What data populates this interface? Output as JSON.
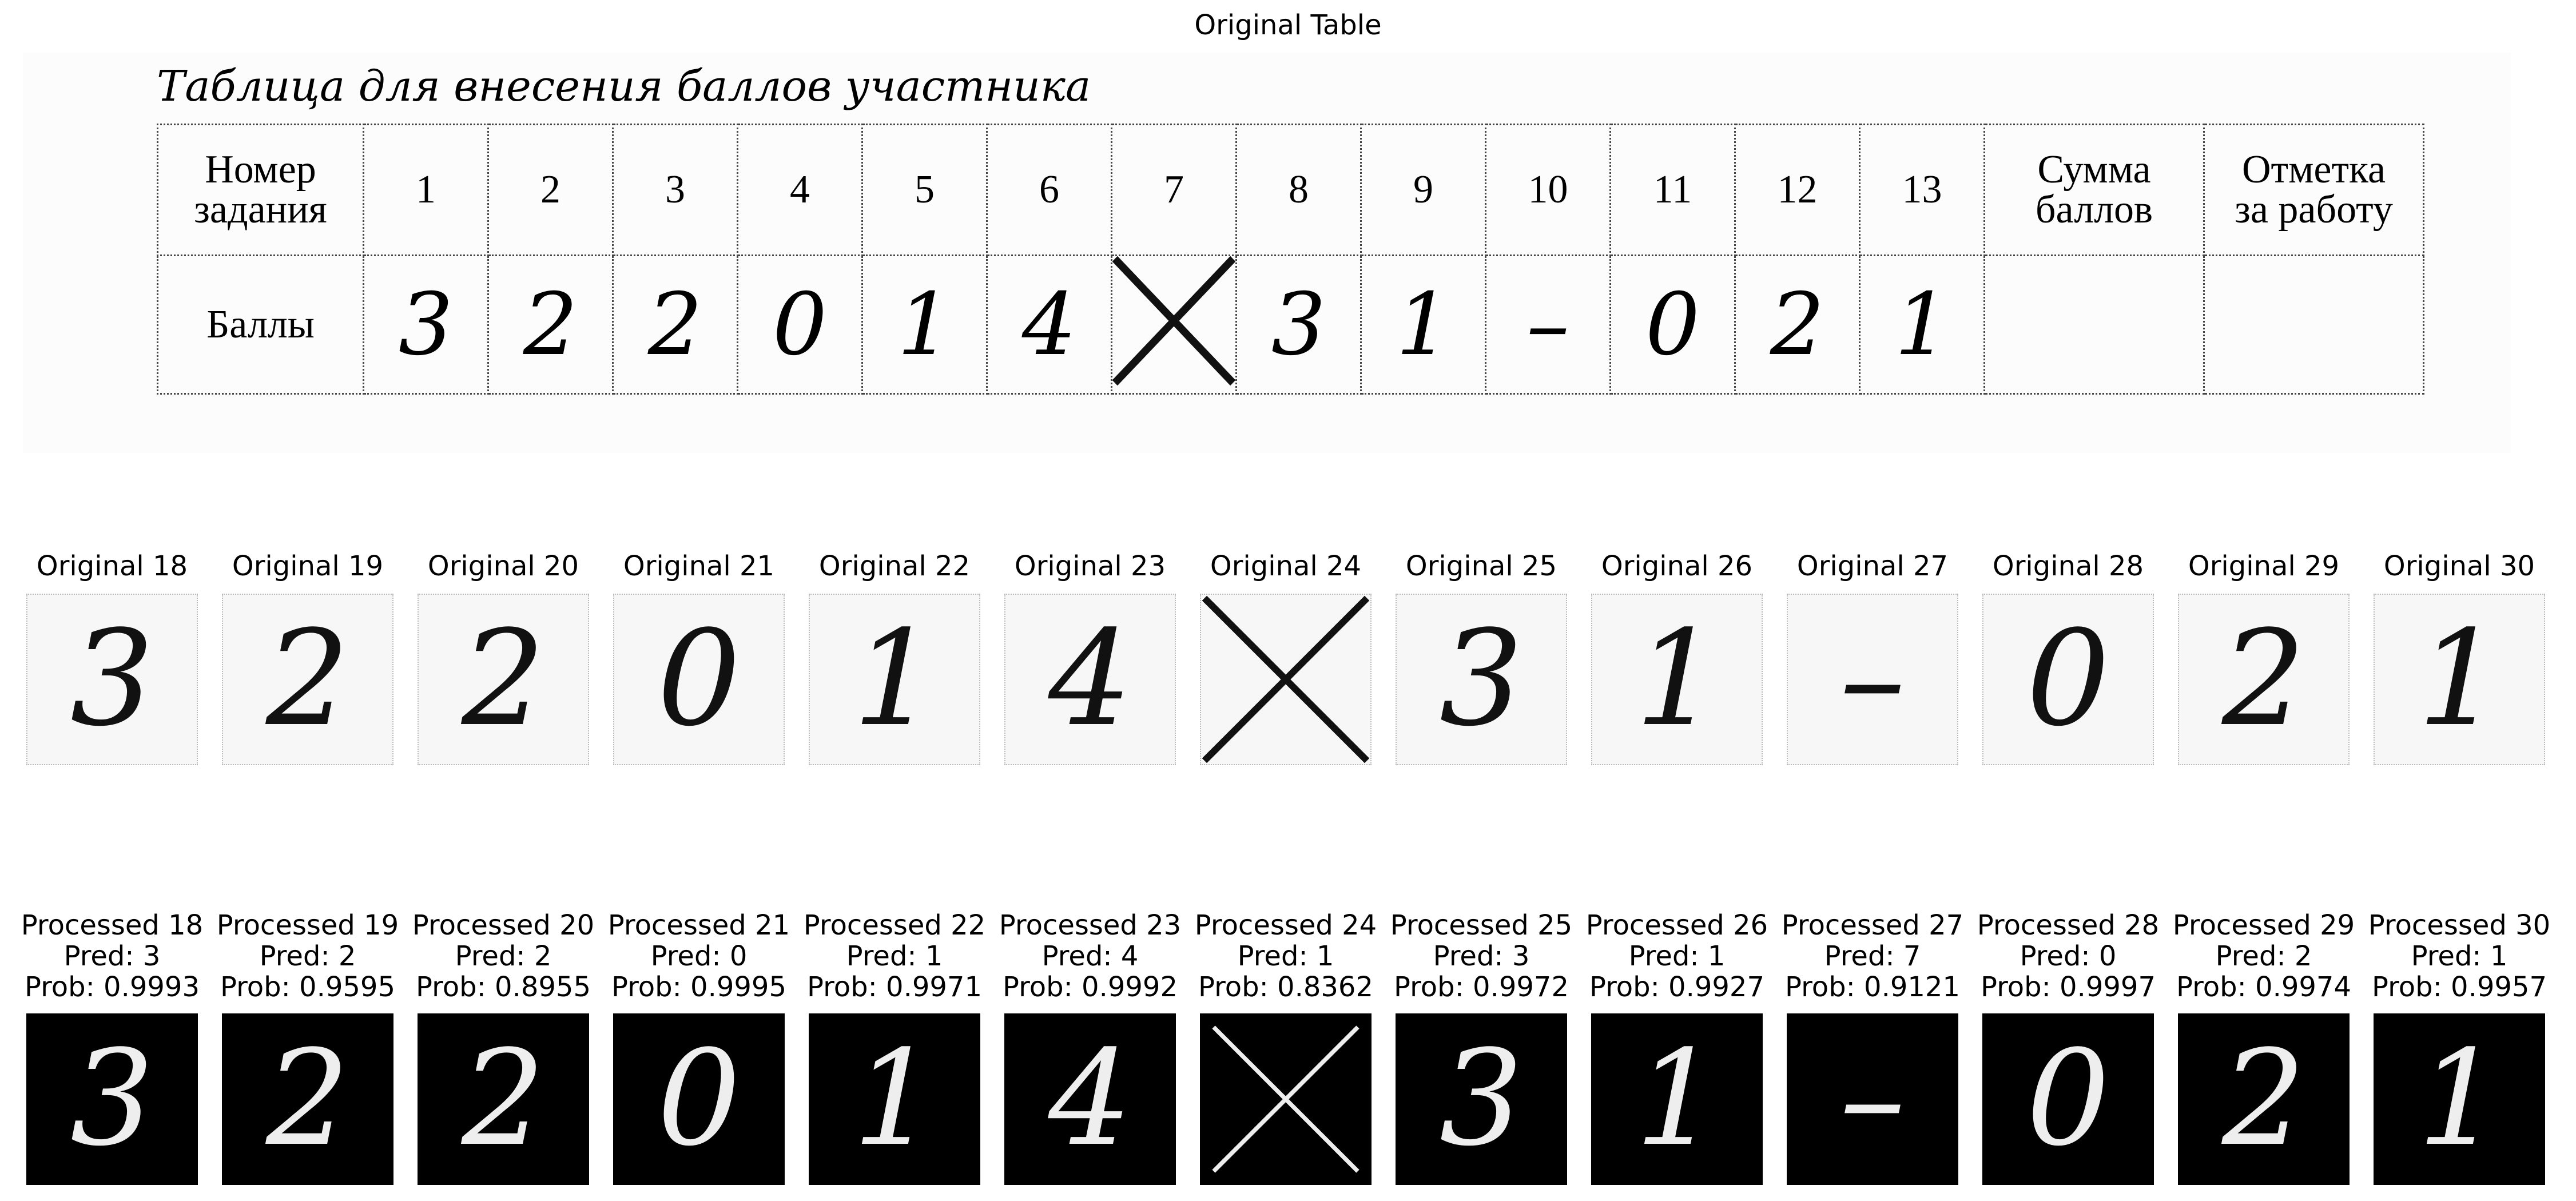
{
  "figure": {
    "title": "Original Table"
  },
  "scan": {
    "caption": "Таблица для внесения баллов участника",
    "header_label": [
      "Номер",
      "задания"
    ],
    "score_label": "Баллы",
    "task_numbers": [
      "1",
      "2",
      "3",
      "4",
      "5",
      "6",
      "7",
      "8",
      "9",
      "10",
      "11",
      "12",
      "13"
    ],
    "scores": [
      "3",
      "2",
      "2",
      "0",
      "1",
      "4",
      "X",
      "3",
      "1",
      "–",
      "0",
      "2",
      "1"
    ],
    "sum_label": [
      "Сумма",
      "баллов"
    ],
    "mark_label": [
      "Отметка",
      "за работу"
    ]
  },
  "crops": [
    {
      "original_label": "Original 18",
      "processed_label": "Processed 18",
      "pred": "Pred: 3",
      "prob": "Prob: 0.9993",
      "glyph": "3"
    },
    {
      "original_label": "Original 19",
      "processed_label": "Processed 19",
      "pred": "Pred: 2",
      "prob": "Prob: 0.9595",
      "glyph": "2"
    },
    {
      "original_label": "Original 20",
      "processed_label": "Processed 20",
      "pred": "Pred: 2",
      "prob": "Prob: 0.8955",
      "glyph": "2"
    },
    {
      "original_label": "Original 21",
      "processed_label": "Processed 21",
      "pred": "Pred: 0",
      "prob": "Prob: 0.9995",
      "glyph": "0"
    },
    {
      "original_label": "Original 22",
      "processed_label": "Processed 22",
      "pred": "Pred: 1",
      "prob": "Prob: 0.9971",
      "glyph": "1"
    },
    {
      "original_label": "Original 23",
      "processed_label": "Processed 23",
      "pred": "Pred: 4",
      "prob": "Prob: 0.9992",
      "glyph": "4"
    },
    {
      "original_label": "Original 24",
      "processed_label": "Processed 24",
      "pred": "Pred: 1",
      "prob": "Prob: 0.8362",
      "glyph": "X"
    },
    {
      "original_label": "Original 25",
      "processed_label": "Processed 25",
      "pred": "Pred: 3",
      "prob": "Prob: 0.9972",
      "glyph": "3"
    },
    {
      "original_label": "Original 26",
      "processed_label": "Processed 26",
      "pred": "Pred: 1",
      "prob": "Prob: 0.9927",
      "glyph": "1"
    },
    {
      "original_label": "Original 27",
      "processed_label": "Processed 27",
      "pred": "Pred: 7",
      "prob": "Prob: 0.9121",
      "glyph": "–"
    },
    {
      "original_label": "Original 28",
      "processed_label": "Processed 28",
      "pred": "Pred: 0",
      "prob": "Prob: 0.9997",
      "glyph": "0"
    },
    {
      "original_label": "Original 29",
      "processed_label": "Processed 29",
      "pred": "Pred: 2",
      "prob": "Prob: 0.9974",
      "glyph": "2"
    },
    {
      "original_label": "Original 30",
      "processed_label": "Processed 30",
      "pred": "Pred: 1",
      "prob": "Prob: 0.9957",
      "glyph": "1"
    }
  ]
}
